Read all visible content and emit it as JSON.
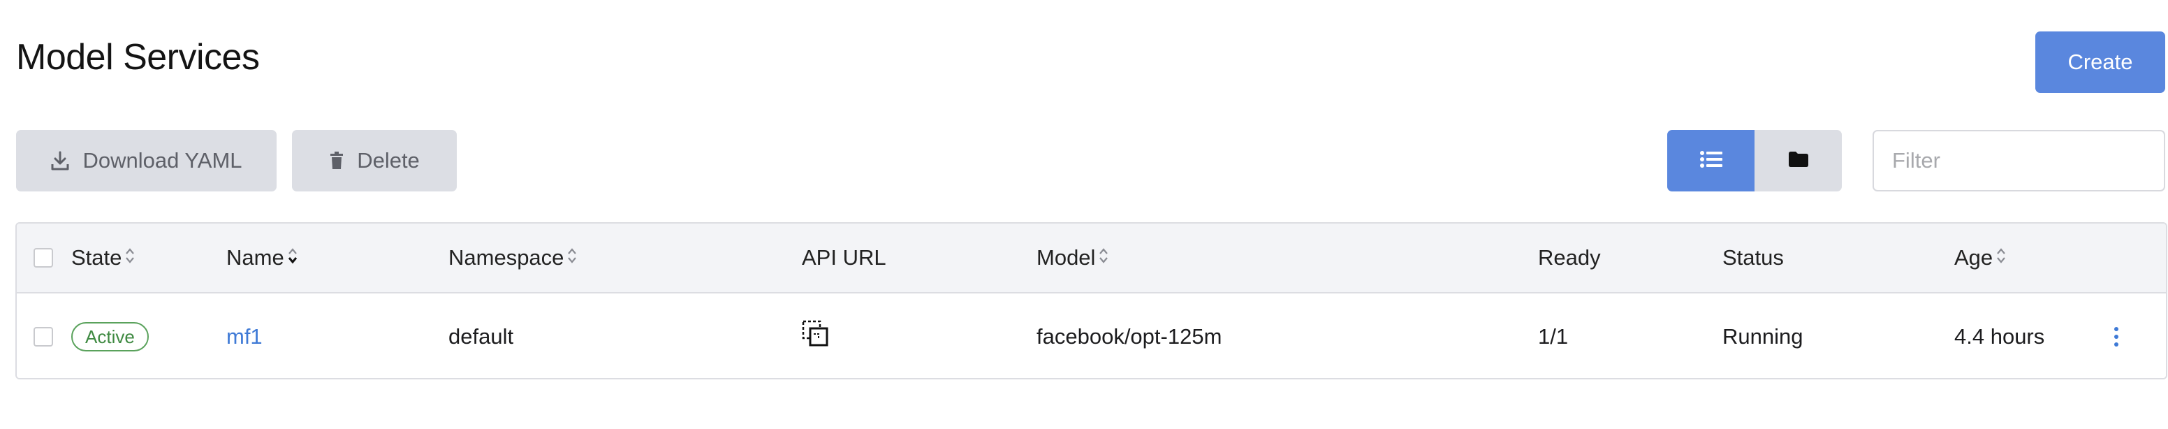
{
  "page": {
    "title": "Model Services"
  },
  "toolbar": {
    "create_label": "Create",
    "download_label": "Download YAML",
    "delete_label": "Delete",
    "filter_placeholder": "Filter",
    "filter_value": ""
  },
  "colors": {
    "accent": "#5a87de",
    "secondary_button": "#dcdee4",
    "active_badge": "#5aa25c",
    "link": "#3f7ad6"
  },
  "icons": {
    "download": "download-icon",
    "delete": "trash-icon",
    "list_view": "list-icon",
    "folder_view": "folder-icon",
    "api_url": "copy-icon",
    "row_actions": "kebab-menu-icon"
  },
  "table": {
    "columns": {
      "state": "State",
      "name": "Name",
      "namespace": "Namespace",
      "api_url": "API URL",
      "model": "Model",
      "ready": "Ready",
      "status": "Status",
      "age": "Age"
    },
    "rows": [
      {
        "state": "Active",
        "name": "mf1",
        "namespace": "default",
        "model": "facebook/opt-125m",
        "ready": "1/1",
        "status": "Running",
        "age": "4.4 hours"
      }
    ]
  }
}
